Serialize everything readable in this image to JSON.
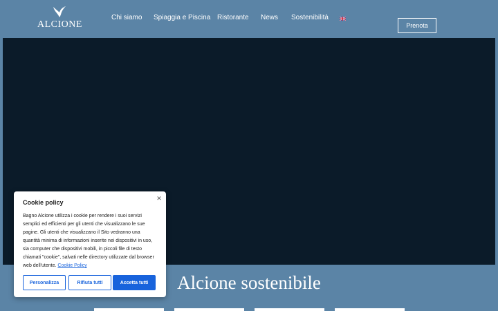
{
  "header": {
    "logo_text": "ALCIONE",
    "nav": [
      {
        "label": "Chi siamo"
      },
      {
        "label": "Spiaggia e Piscina"
      },
      {
        "label": "Ristorante"
      },
      {
        "label": "News"
      },
      {
        "label": "Sostenibilità"
      }
    ],
    "language_icon": "uk-flag-icon",
    "cta_label": "Prenota"
  },
  "hero": {
    "media_icon": "video-background"
  },
  "section": {
    "title": "Alcione sostenibile"
  },
  "cookie_banner": {
    "title": "Cookie policy",
    "close_icon": "close-icon",
    "body": "Bagno Alcione utilizza i cookie per rendere i suoi servizi semplici ed efficienti per gli utenti che visualizzano le sue pagine. Gli utenti che visualizzano il Sito vedranno una quantità minima di informazioni inserite nei dispositivi in uso, sia computer che dispositivi mobili, in piccoli file di testo chiamati \"cookie\", salvati nelle directory utilizzate dal browser web dell'utente.",
    "link_label": "Cookie Policy",
    "buttons": {
      "customize": "Personalizza",
      "reject": "Rifiuta tutti",
      "accept": "Accetta tutti"
    }
  },
  "colors": {
    "header_bg": "#5b84a6",
    "hero_bg": "#0b1b29",
    "accent_blue": "#1863dc"
  }
}
